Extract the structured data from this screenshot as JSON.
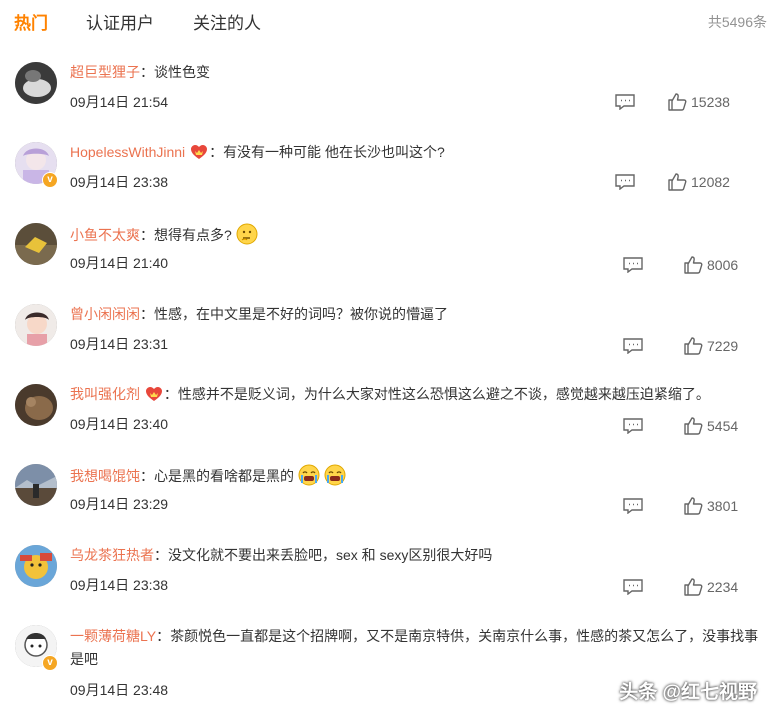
{
  "tabs": [
    {
      "label": "热门"
    },
    {
      "label": "认证用户"
    },
    {
      "label": "关注的人"
    }
  ],
  "total": "共5496条",
  "comments": [
    {
      "user": "超巨型狸子",
      "text": "谈性色变",
      "time": "09月14日 21:54",
      "likes": "15238"
    },
    {
      "user": "HopelessWithJinni",
      "text": "有没有一种可能 他在长沙也叫这个?",
      "time": "09月14日 23:38",
      "likes": "12082"
    },
    {
      "user": "小鱼不太爽",
      "text": "想得有点多?",
      "time": "09月14日 21:40",
      "likes": "8006"
    },
    {
      "user": "曾小闲闲闲",
      "text": "性感，在中文里是不好的词吗？被你说的懵逼了",
      "time": "09月14日 23:31",
      "likes": "7229"
    },
    {
      "user": "我叫强化剂",
      "text": "性感并不是贬义词，为什么大家对性这么恐惧这么避之不谈，感觉越来越压迫紧缩了。",
      "time": "09月14日 23:40",
      "likes": "5454"
    },
    {
      "user": "我想喝馄饨",
      "text": "心是黑的看啥都是黑的",
      "time": "09月14日 23:29",
      "likes": "3801"
    },
    {
      "user": "乌龙茶狂热者",
      "text": "没文化就不要出来丢脸吧，sex 和 sexy区别很大好吗",
      "time": "09月14日 23:38",
      "likes": "2234"
    },
    {
      "user": "一颗薄荷糖LY",
      "text": "茶颜悦色一直都是这个招牌啊，又不是南京特供，关南京什么事，性感的茶又怎么了，没事找事是吧",
      "time": "09月14日 23:48",
      "likes": ""
    }
  ],
  "separator": "：",
  "watermark": "头条 @红七视野",
  "colors": {
    "accent": "#ff8200",
    "username": "#eb7350",
    "badge": "#f5a623"
  }
}
